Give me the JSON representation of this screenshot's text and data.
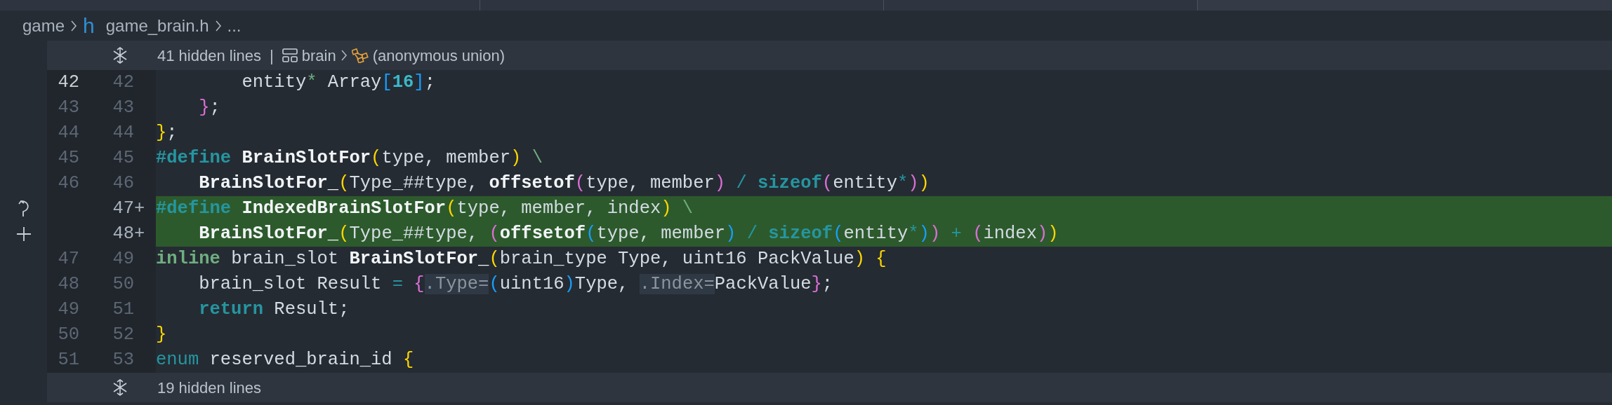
{
  "breadcrumb": [
    {
      "kind": "folder",
      "label": "game"
    },
    {
      "kind": "file",
      "icon": "h",
      "label": "game_brain.h"
    },
    {
      "kind": "more",
      "label": "..."
    }
  ],
  "top_fold": {
    "label": "41 hidden lines",
    "separator": "|",
    "path": [
      {
        "kind": "struct",
        "label": "brain"
      },
      {
        "kind": "union",
        "label": "(anonymous union)"
      }
    ]
  },
  "lines": [
    {
      "old": "42",
      "new": "42",
      "current": true,
      "added": false,
      "tokens": [
        {
          "kind": "plain",
          "s": "        entity"
        },
        {
          "kind": "green",
          "s": "*"
        },
        {
          "kind": "plain",
          "s": " Array"
        },
        {
          "kind": "blue",
          "s": "["
        },
        {
          "kind": "number",
          "s": "16"
        },
        {
          "kind": "blue",
          "s": "]"
        },
        {
          "kind": "plain",
          "s": ";"
        }
      ]
    },
    {
      "old": "43",
      "new": "43",
      "current": false,
      "added": false,
      "tokens": [
        {
          "kind": "pink",
          "s": "    }"
        },
        {
          "kind": "plain",
          "s": ";"
        }
      ]
    },
    {
      "old": "44",
      "new": "44",
      "current": false,
      "added": false,
      "tokens": [
        {
          "kind": "yellow",
          "s": "}"
        },
        {
          "kind": "plain",
          "s": ";"
        }
      ]
    },
    {
      "old": "45",
      "new": "45",
      "current": false,
      "added": false,
      "tokens": [
        {
          "kind": "keyword",
          "s": "#define "
        },
        {
          "kind": "func",
          "s": "BrainSlotFor"
        },
        {
          "kind": "yellow",
          "s": "("
        },
        {
          "kind": "plain",
          "s": "type, member"
        },
        {
          "kind": "yellow",
          "s": ") "
        },
        {
          "kind": "green",
          "s": "\\"
        }
      ]
    },
    {
      "old": "46",
      "new": "46",
      "current": false,
      "added": false,
      "tokens": [
        {
          "kind": "func",
          "s": "    BrainSlotFor_"
        },
        {
          "kind": "yellow",
          "s": "("
        },
        {
          "kind": "plain",
          "s": "Type_##type, "
        },
        {
          "kind": "func",
          "s": "offsetof"
        },
        {
          "kind": "pink",
          "s": "("
        },
        {
          "kind": "plain",
          "s": "type, member"
        },
        {
          "kind": "pink",
          "s": ") "
        },
        {
          "kind": "operator",
          "s": "/ "
        },
        {
          "kind": "keyword",
          "s": "sizeof"
        },
        {
          "kind": "pink",
          "s": "("
        },
        {
          "kind": "plain",
          "s": "entity"
        },
        {
          "kind": "operator",
          "s": "*"
        },
        {
          "kind": "pink",
          "s": ")"
        },
        {
          "kind": "yellow",
          "s": ")"
        }
      ]
    },
    {
      "new": "47",
      "marker": "+",
      "added": true,
      "tokens": [
        {
          "kind": "keyword",
          "s": "#define "
        },
        {
          "kind": "func",
          "s": "IndexedBrainSlotFor"
        },
        {
          "kind": "yellow",
          "s": "("
        },
        {
          "kind": "plain",
          "s": "type, member, index"
        },
        {
          "kind": "yellow",
          "s": ") "
        },
        {
          "kind": "green",
          "s": "\\"
        }
      ]
    },
    {
      "new": "48",
      "marker": "+",
      "added": true,
      "tokens": [
        {
          "kind": "func",
          "s": "    BrainSlotFor_"
        },
        {
          "kind": "yellow",
          "s": "("
        },
        {
          "kind": "plain",
          "s": "Type_##type, "
        },
        {
          "kind": "pink",
          "s": "("
        },
        {
          "kind": "func",
          "s": "offsetof"
        },
        {
          "kind": "blue",
          "s": "("
        },
        {
          "kind": "plain",
          "s": "type, member"
        },
        {
          "kind": "blue",
          "s": ") "
        },
        {
          "kind": "operator",
          "s": "/ "
        },
        {
          "kind": "keyword",
          "s": "sizeof"
        },
        {
          "kind": "blue",
          "s": "("
        },
        {
          "kind": "plain",
          "s": "entity"
        },
        {
          "kind": "operator",
          "s": "*"
        },
        {
          "kind": "blue",
          "s": ")"
        },
        {
          "kind": "pink",
          "s": ")"
        },
        {
          "kind": "operator",
          "s": " + "
        },
        {
          "kind": "pink",
          "s": "("
        },
        {
          "kind": "plain",
          "s": "index"
        },
        {
          "kind": "pink",
          "s": ")"
        },
        {
          "kind": "yellow",
          "s": ")"
        }
      ]
    },
    {
      "old": "47",
      "new": "49",
      "current": false,
      "added": false,
      "tokens": [
        {
          "kind": "green-bold",
          "s": "inline"
        },
        {
          "kind": "plain",
          "s": " brain_slot "
        },
        {
          "kind": "func",
          "s": "BrainSlotFor_"
        },
        {
          "kind": "yellow",
          "s": "("
        },
        {
          "kind": "plain",
          "s": "brain_type Type, uint16 PackValue"
        },
        {
          "kind": "yellow",
          "s": ") {"
        }
      ]
    },
    {
      "old": "48",
      "new": "50",
      "current": false,
      "added": false,
      "tokens": [
        {
          "kind": "plain",
          "s": "    brain_slot Result "
        },
        {
          "kind": "operator",
          "s": "= "
        },
        {
          "kind": "pink",
          "s": "{"
        },
        {
          "kind": "hint",
          "s": ".Type="
        },
        {
          "kind": "blue",
          "s": "("
        },
        {
          "kind": "plain",
          "s": "uint16"
        },
        {
          "kind": "blue",
          "s": ")"
        },
        {
          "kind": "plain",
          "s": "Type, "
        },
        {
          "kind": "hint",
          "s": ".Index="
        },
        {
          "kind": "plain",
          "s": "PackValue"
        },
        {
          "kind": "pink",
          "s": "}"
        },
        {
          "kind": "plain",
          "s": ";"
        }
      ]
    },
    {
      "old": "49",
      "new": "51",
      "current": false,
      "added": false,
      "tokens": [
        {
          "kind": "keyword",
          "s": "    return"
        },
        {
          "kind": "plain",
          "s": " Result;"
        }
      ]
    },
    {
      "old": "50",
      "new": "52",
      "current": false,
      "added": false,
      "tokens": [
        {
          "kind": "yellow",
          "s": "}"
        }
      ]
    },
    {
      "old": "51",
      "new": "53",
      "current": false,
      "added": false,
      "tokens": [
        {
          "kind": "operator",
          "s": "enum"
        },
        {
          "kind": "plain",
          "s": " reserved_brain_id "
        },
        {
          "kind": "yellow",
          "s": "{"
        }
      ]
    }
  ],
  "bottom_fold": {
    "label": "19 hidden lines"
  }
}
